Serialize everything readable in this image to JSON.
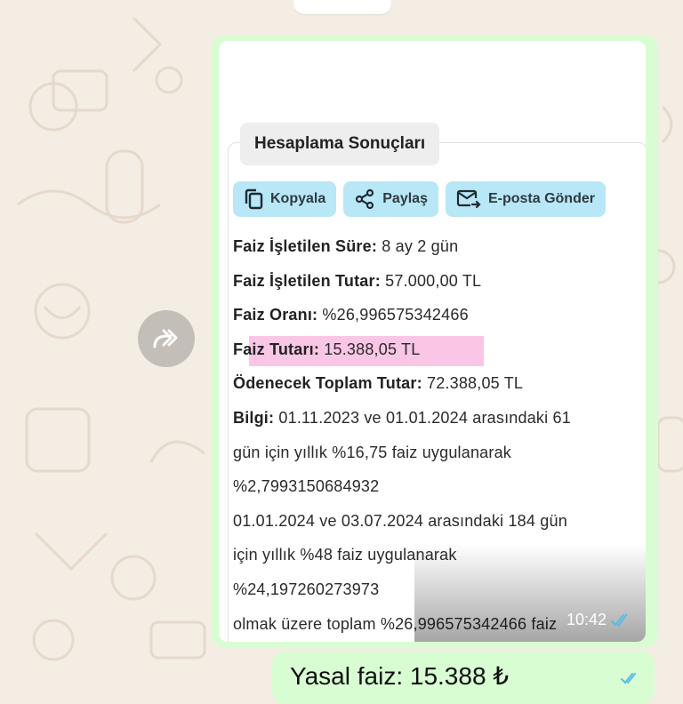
{
  "app": "WhatsApp chat",
  "colors": {
    "bubble_out": "#d9fdd3",
    "chip_bg": "#b8e7f7",
    "highlight": "#f7a7d9",
    "read_ticks": "#53bdeb",
    "wallpaper": "#f3ede4"
  },
  "forward_icon": "forward-icon",
  "image_message": {
    "card_title": "Hesaplama Sonuçları",
    "actions": [
      {
        "label": "Kopyala",
        "icon": "copy-icon"
      },
      {
        "label": "Paylaş",
        "icon": "share-icon"
      },
      {
        "label": "E-posta Gönder",
        "icon": "email-send-icon"
      }
    ],
    "results": [
      {
        "label": "Faiz İşletilen Süre:",
        "value": " 8 ay 2 gün"
      },
      {
        "label": "Faiz İşletilen Tutar:",
        "value": " 57.000,00 TL"
      },
      {
        "label": "Faiz Oranı:",
        "value": " %26,996575342466"
      },
      {
        "label": "Faiz Tutarı:",
        "value": " 15.388,05 TL"
      },
      {
        "label": "Ödenecek Toplam Tutar:",
        "value": " 72.388,05 TL"
      },
      {
        "label": "Bilgi:",
        "value": " 01.11.2023 ve 01.01.2024 arasındaki 61"
      }
    ],
    "info_lines": [
      "gün için yıllık %16,75 faiz uygulanarak",
      "%2,7993150684932",
      "01.01.2024 ve 03.07.2024 arasındaki 184 gün",
      "için yıllık %48 faiz uygulanarak",
      "%24,197260273973",
      "olmak üzere toplam %26,996575342466 faiz"
    ],
    "time": "10:42"
  },
  "next_message": {
    "text": "Yasal faiz: 15.388 ₺"
  }
}
